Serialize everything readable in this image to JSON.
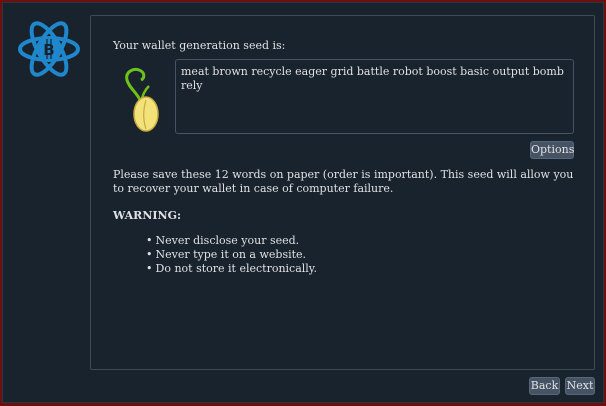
{
  "wizard": {
    "heading": "Your wallet generation seed is:",
    "seed_words": "meat brown recycle eager grid battle robot boost basic output bomb rely",
    "options_label": "Options",
    "info_text": "Please save these 12 words on paper (order is important). This seed will allow you to recover your wallet in case of computer failure.",
    "warning_label": "WARNING:",
    "bullets": [
      "Never disclose your seed.",
      "Never type it on a website.",
      "Do not store it electronically."
    ],
    "back_label": "Back",
    "next_label": "Next"
  },
  "icons": {
    "logo": "electrum-bitcoin-atom-icon",
    "seed": "sprouting-seed-icon"
  },
  "colors": {
    "background": "#19232d",
    "accent_blue": "#1f87cc",
    "text": "#e0e1e3",
    "button": "#455364",
    "frame": "#6b0f0f"
  }
}
